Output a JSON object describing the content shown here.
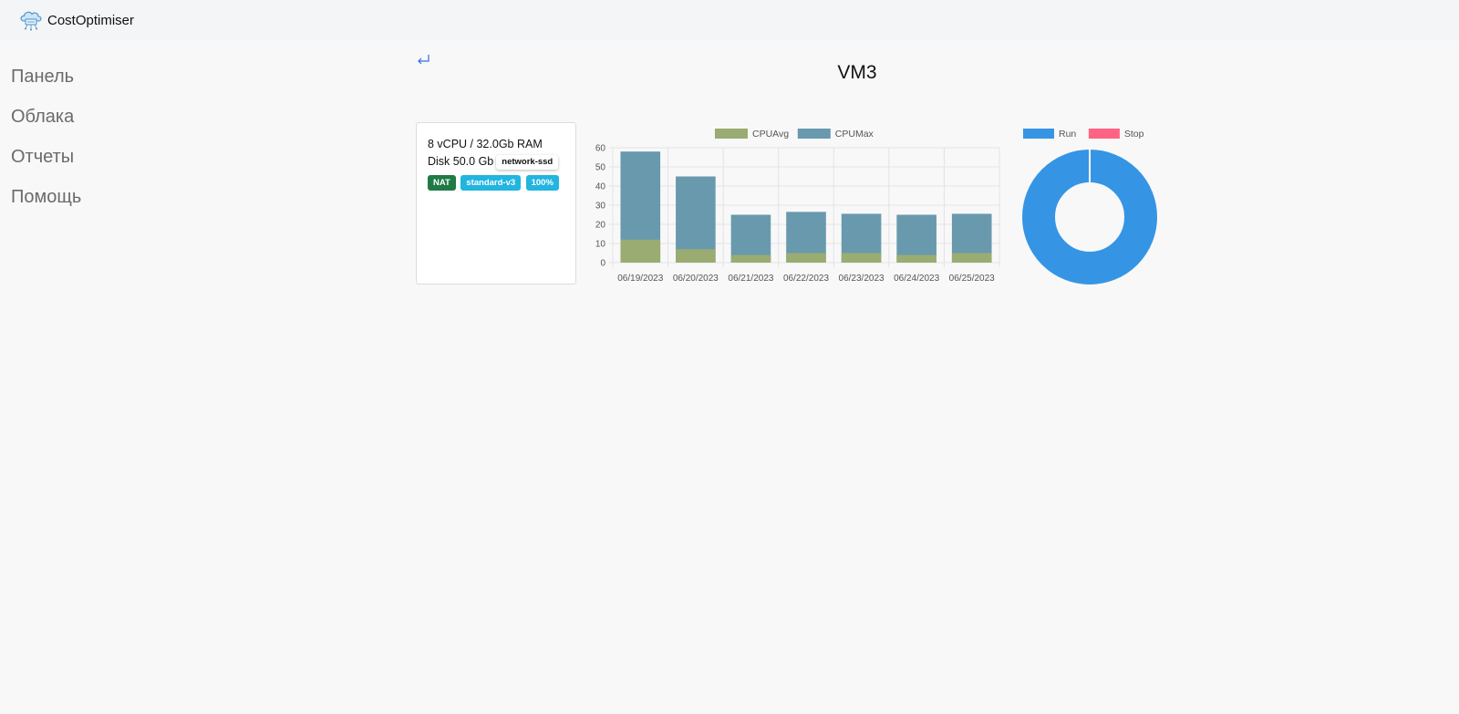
{
  "app": {
    "brand": "CostOptimiser"
  },
  "sidebar": {
    "items": [
      {
        "label": "Панель"
      },
      {
        "label": "Облака"
      },
      {
        "label": "Отчеты"
      },
      {
        "label": "Помощь"
      }
    ]
  },
  "page": {
    "back_icon": "return-arrow-icon",
    "title": "VM3"
  },
  "vm": {
    "spec": "8 vCPU / 32.0Gb RAM",
    "disk": "Disk 50.0 Gb",
    "disk_type": "network-ssd",
    "badges": [
      "NAT",
      "standard-v3",
      "100%"
    ]
  },
  "colors": {
    "cpu_avg": "#9aac72",
    "cpu_max": "#6999ad",
    "run": "#3595e4",
    "stop": "#ff6384",
    "nat": "#1f7a45",
    "cyan": "#21b5e0"
  },
  "chart_data": [
    {
      "type": "bar",
      "stacked": false,
      "categories": [
        "06/19/2023",
        "06/20/2023",
        "06/21/2023",
        "06/22/2023",
        "06/23/2023",
        "06/24/2023",
        "06/25/2023"
      ],
      "series": [
        {
          "name": "CPUAvg",
          "values": [
            12,
            7,
            4,
            5,
            5,
            4,
            5
          ]
        },
        {
          "name": "CPUMax",
          "values": [
            58,
            45,
            25,
            26.5,
            25.5,
            25,
            25.5
          ]
        }
      ],
      "yticks": [
        0,
        10,
        20,
        30,
        40,
        50,
        60
      ],
      "ylim": [
        0,
        60
      ],
      "grid": true,
      "legend": "top"
    },
    {
      "type": "pie",
      "variant": "doughnut",
      "labels": [
        "Run",
        "Stop"
      ],
      "values": [
        100,
        0
      ],
      "legend": "top"
    }
  ]
}
